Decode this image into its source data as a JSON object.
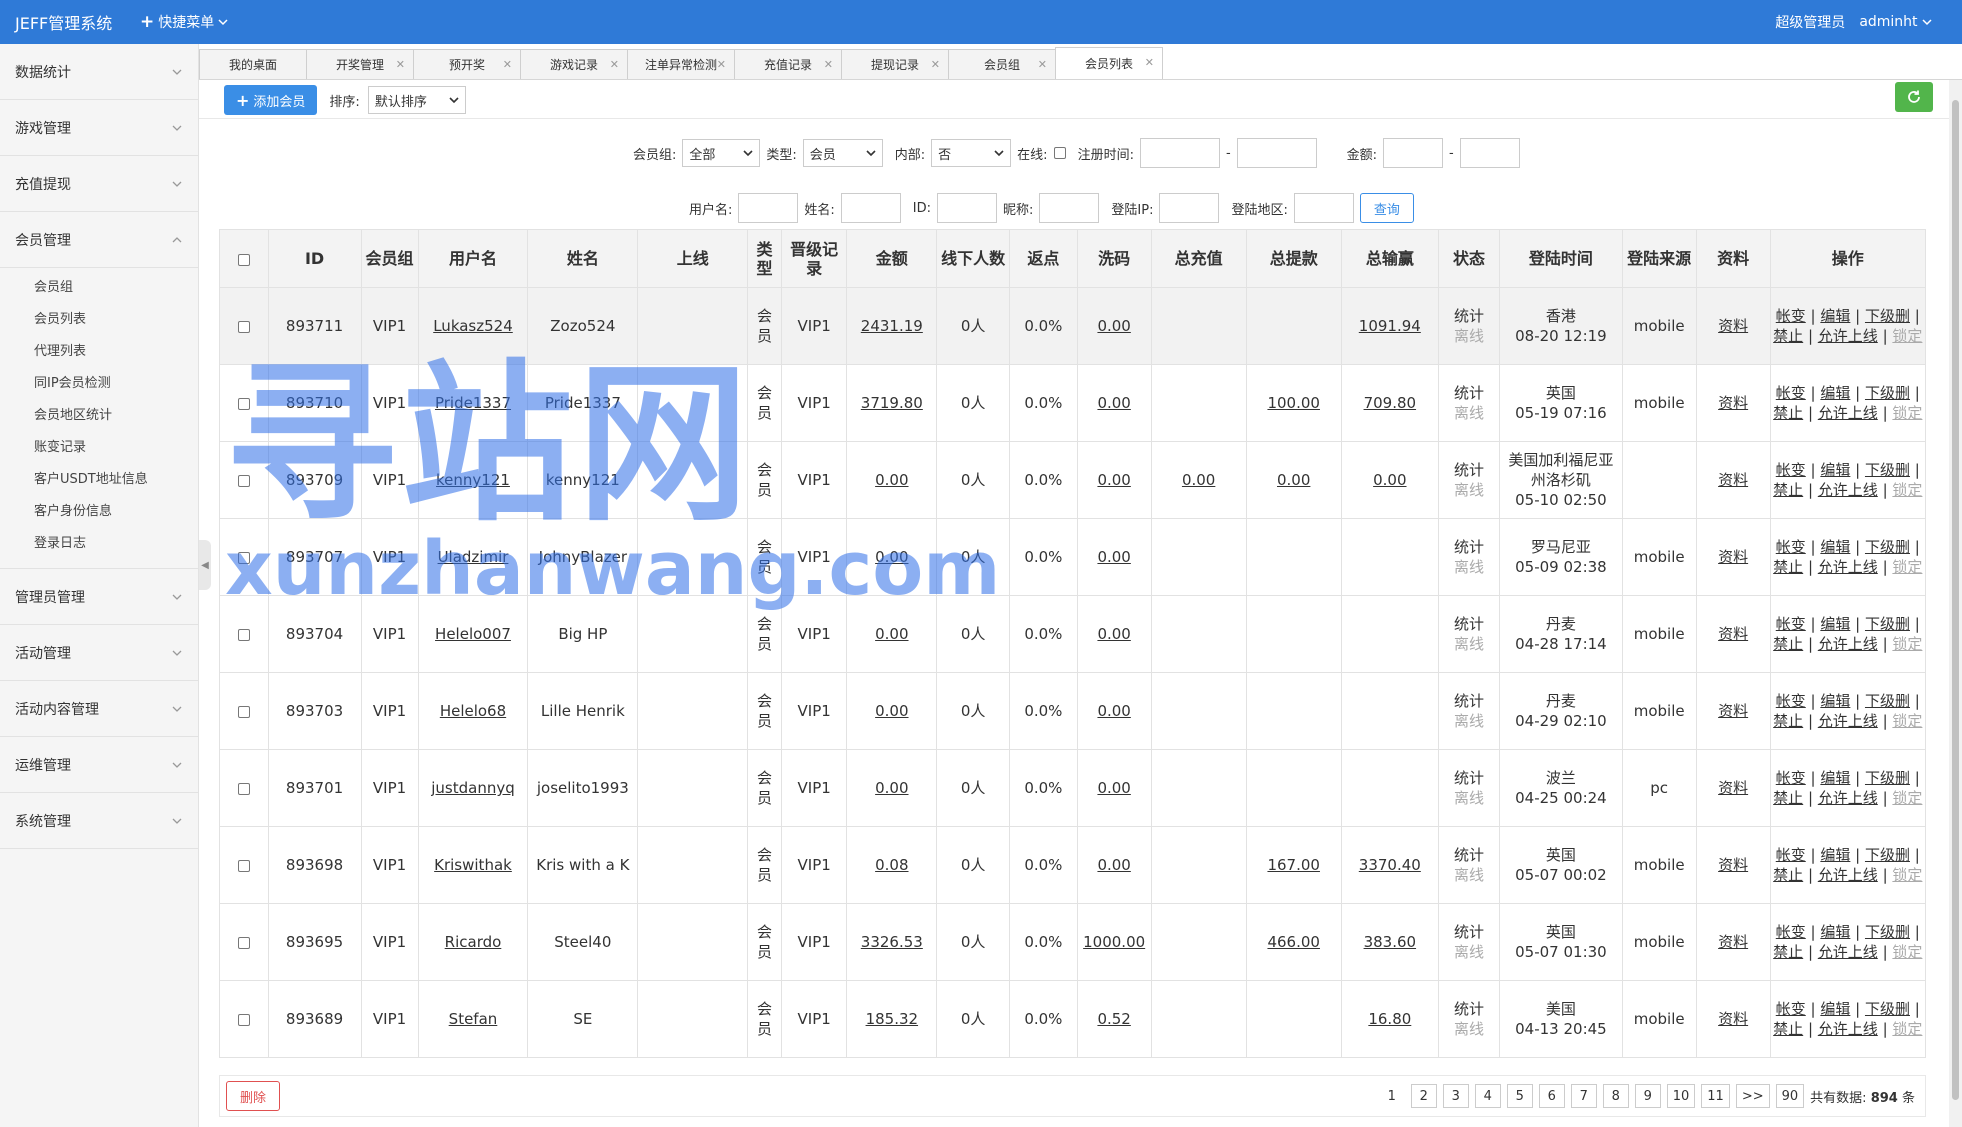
{
  "header": {
    "app_title": "JEFF管理系统",
    "quick_menu": "快捷菜单",
    "role": "超级管理员",
    "user": "adminht"
  },
  "sidebar": {
    "groups": [
      {
        "label": "数据统计"
      },
      {
        "label": "游戏管理"
      },
      {
        "label": "充值提现"
      },
      {
        "label": "会员管理",
        "expanded": true
      }
    ],
    "member_items": [
      "会员组",
      "会员列表",
      "代理列表",
      "同IP会员检测",
      "会员地区统计",
      "账变记录",
      "客户USDT地址信息",
      "客户身份信息",
      "登录日志"
    ],
    "groups_after": [
      {
        "label": "管理员管理"
      },
      {
        "label": "活动管理"
      },
      {
        "label": "活动内容管理"
      },
      {
        "label": "运维管理"
      },
      {
        "label": "系统管理"
      }
    ]
  },
  "tabs": [
    {
      "label": "我的桌面",
      "closable": false
    },
    {
      "label": "开奖管理",
      "closable": true
    },
    {
      "label": "预开奖",
      "closable": true
    },
    {
      "label": "游戏记录",
      "closable": true
    },
    {
      "label": "注单异常检测",
      "closable": true
    },
    {
      "label": "充值记录",
      "closable": true
    },
    {
      "label": "提现记录",
      "closable": true
    },
    {
      "label": "会员组",
      "closable": true
    },
    {
      "label": "会员列表",
      "closable": true,
      "active": true
    }
  ],
  "toolbar": {
    "add_member": "添加会员",
    "sort_label": "排序:",
    "sort_value": "默认排序"
  },
  "filters": {
    "group_label": "会员组:",
    "group_value": "全部",
    "type_label": "类型:",
    "type_value": "会员",
    "internal_label": "内部:",
    "internal_value": "否",
    "online_label": "在线:",
    "reg_time_label": "注册时间:",
    "dash": "-",
    "amount_label": "金额:",
    "username_label": "用户名:",
    "name_label": "姓名:",
    "id_label": "ID:",
    "nickname_label": "昵称:",
    "login_ip_label": "登陆IP:",
    "login_region_label": "登陆地区:",
    "query": "查询"
  },
  "table": {
    "headers": [
      "ID",
      "会员组",
      "用户名",
      "姓名",
      "上线",
      "类型",
      "晋级记录",
      "金额",
      "线下人数",
      "返点",
      "洗码",
      "总充值",
      "总提款",
      "总输赢",
      "状态",
      "登陆时间",
      "登陆来源",
      "资料",
      "操作"
    ],
    "rows": [
      {
        "id": "893711",
        "group": "VIP1",
        "username": "Lukasz524",
        "name": "Zozo524",
        "upline": "",
        "type": "会员",
        "promo": "VIP1",
        "amount": "2431.19",
        "downline": "0人",
        "rebate": "0.0%",
        "wash": "0.00",
        "recharge": "",
        "withdraw": "",
        "winloss": "1091.94",
        "stat": "统计",
        "online": "离线",
        "region": "香港",
        "login_time": "08-20 12:19",
        "source": "mobile",
        "profile": "资料"
      },
      {
        "id": "893710",
        "group": "VIP1",
        "username": "Pride1337",
        "name": "Pride1337",
        "upline": "",
        "type": "会员",
        "promo": "VIP1",
        "amount": "3719.80",
        "downline": "0人",
        "rebate": "0.0%",
        "wash": "0.00",
        "recharge": "",
        "withdraw": "100.00",
        "winloss": "709.80",
        "stat": "统计",
        "online": "离线",
        "region": "英国",
        "login_time": "05-19 07:16",
        "source": "mobile",
        "profile": "资料"
      },
      {
        "id": "893709",
        "group": "VIP1",
        "username": "kenny121",
        "name": "kenny121",
        "upline": "",
        "type": "会员",
        "promo": "VIP1",
        "amount": "0.00",
        "downline": "0人",
        "rebate": "0.0%",
        "wash": "0.00",
        "recharge": "0.00",
        "withdraw": "0.00",
        "winloss": "0.00",
        "stat": "统计",
        "online": "离线",
        "region": "美国加利福尼亚州洛杉矶",
        "login_time": "05-10 02:50",
        "source": "",
        "profile": "资料"
      },
      {
        "id": "893707",
        "group": "VIP1",
        "username": "Uladzimir",
        "name": "JohnyBlazer",
        "upline": "",
        "type": "会员",
        "promo": "VIP1",
        "amount": "0.00",
        "downline": "0人",
        "rebate": "0.0%",
        "wash": "0.00",
        "recharge": "",
        "withdraw": "",
        "winloss": "",
        "stat": "统计",
        "online": "离线",
        "region": "罗马尼亚",
        "login_time": "05-09 02:38",
        "source": "mobile",
        "profile": "资料"
      },
      {
        "id": "893704",
        "group": "VIP1",
        "username": "Helelo007",
        "name": "Big HP",
        "upline": "",
        "type": "会员",
        "promo": "VIP1",
        "amount": "0.00",
        "downline": "0人",
        "rebate": "0.0%",
        "wash": "0.00",
        "recharge": "",
        "withdraw": "",
        "winloss": "",
        "stat": "统计",
        "online": "离线",
        "region": "丹麦",
        "login_time": "04-28 17:14",
        "source": "mobile",
        "profile": "资料"
      },
      {
        "id": "893703",
        "group": "VIP1",
        "username": "Helelo68",
        "name": "Lille Henrik",
        "upline": "",
        "type": "会员",
        "promo": "VIP1",
        "amount": "0.00",
        "downline": "0人",
        "rebate": "0.0%",
        "wash": "0.00",
        "recharge": "",
        "withdraw": "",
        "winloss": "",
        "stat": "统计",
        "online": "离线",
        "region": "丹麦",
        "login_time": "04-29 02:10",
        "source": "mobile",
        "profile": "资料"
      },
      {
        "id": "893701",
        "group": "VIP1",
        "username": "justdannyq",
        "name": "joselito1993",
        "upline": "",
        "type": "会员",
        "promo": "VIP1",
        "amount": "0.00",
        "downline": "0人",
        "rebate": "0.0%",
        "wash": "0.00",
        "recharge": "",
        "withdraw": "",
        "winloss": "",
        "stat": "统计",
        "online": "离线",
        "region": "波兰",
        "login_time": "04-25 00:24",
        "source": "pc",
        "profile": "资料"
      },
      {
        "id": "893698",
        "group": "VIP1",
        "username": "Kriswithak",
        "name": "Kris with a K",
        "upline": "",
        "type": "会员",
        "promo": "VIP1",
        "amount": "0.08",
        "downline": "0人",
        "rebate": "0.0%",
        "wash": "0.00",
        "recharge": "",
        "withdraw": "167.00",
        "winloss": "3370.40",
        "stat": "统计",
        "online": "离线",
        "region": "英国",
        "login_time": "05-07 00:02",
        "source": "mobile",
        "profile": "资料"
      },
      {
        "id": "893695",
        "group": "VIP1",
        "username": "Ricardo",
        "name": "Steel40",
        "upline": "",
        "type": "会员",
        "promo": "VIP1",
        "amount": "3326.53",
        "downline": "0人",
        "rebate": "0.0%",
        "wash": "1000.00",
        "recharge": "",
        "withdraw": "466.00",
        "winloss": "383.60",
        "stat": "统计",
        "online": "离线",
        "region": "英国",
        "login_time": "05-07 01:30",
        "source": "mobile",
        "profile": "资料"
      },
      {
        "id": "893689",
        "group": "VIP1",
        "username": "Stefan",
        "name": "SE",
        "upline": "",
        "type": "会员",
        "promo": "VIP1",
        "amount": "185.32",
        "downline": "0人",
        "rebate": "0.0%",
        "wash": "0.52",
        "recharge": "",
        "withdraw": "",
        "winloss": "16.80",
        "stat": "统计",
        "online": "离线",
        "region": "美国",
        "login_time": "04-13 20:45",
        "source": "mobile",
        "profile": "资料"
      }
    ],
    "ops": {
      "change": "帐变",
      "edit": "编辑",
      "down": "下级",
      "del": "删",
      "ban": "禁止",
      "allow": "允许上线",
      "lock": "锁定",
      "sep": "|"
    }
  },
  "footer": {
    "delete": "删除",
    "pages": [
      "1",
      "2",
      "3",
      "4",
      "5",
      "6",
      "7",
      "8",
      "9",
      "10",
      "11",
      ">>",
      "90"
    ],
    "current_page": "1",
    "total_label": "共有数据:",
    "total_count": "894",
    "total_unit": "条"
  },
  "watermark": {
    "big": "寻站网",
    "small": "xunzhanwang.com"
  },
  "colors": {
    "header": "#2f7ad7",
    "primary": "#3a8ee6",
    "refresh": "#52b54b",
    "danger": "#e05050",
    "watermark": "#2f6fe8"
  }
}
